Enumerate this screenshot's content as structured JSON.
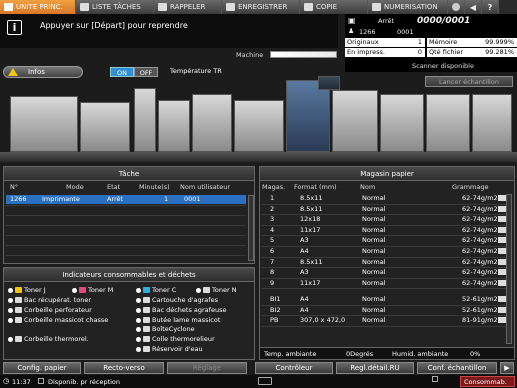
{
  "tabs": [
    {
      "label": "UNITE PRINC.",
      "icon": "home-icon",
      "active": true
    },
    {
      "label": "LISTE TÂCHES",
      "icon": "list-icon",
      "active": false
    },
    {
      "label": "RAPPELER",
      "icon": "folder-icon",
      "active": false
    },
    {
      "label": "ENREGISTRER",
      "icon": "save-icon",
      "active": false
    },
    {
      "label": "COPIE",
      "icon": "copy-icon",
      "active": false
    },
    {
      "label": "NUMERISATION",
      "icon": "scan-icon",
      "active": false
    }
  ],
  "message": "Appuyer sur [Départ] pour reprendre",
  "status": {
    "state_label": "Arrêt",
    "counter": "0000/0001",
    "job_id": "1266",
    "job_count": "0001",
    "originals_label": "Originaux",
    "originals_value": "1",
    "memory_label": "Mémoire",
    "memory_value": "99.999%",
    "printing_label": "En impress.",
    "printing_value": "0",
    "file_qty_label": "Qté fichier",
    "file_qty_value": "99.281%"
  },
  "machine_label": "Machine",
  "machine_progress": 1.0,
  "infos_label": "Infos",
  "on_label": "ON",
  "off_label": "OFF",
  "temp_label": "Température TR",
  "scanner_status": "Scanner disponible",
  "scan_sample_label": "Lancer échantillon",
  "jobs": {
    "title": "Tâche",
    "headers": [
      "N°",
      "Mode",
      "Etat",
      "Minute(s)",
      "Nom utilisateur"
    ],
    "rows": [
      {
        "no": "1266",
        "mode": "Imprimante",
        "state": "Arrêt",
        "minutes": "1",
        "user": "0001"
      }
    ]
  },
  "consumables": {
    "title": "Indicateurs consommables et déchets",
    "items": [
      "Toner J",
      "Toner M",
      "Toner C",
      "Toner N",
      "Bac récupérat. toner",
      "Cartouche d'agrafes",
      "Corbeille perforateur",
      "Bac déchets agrafeuse",
      "Corbeille massicot chasse",
      "Butée lame massicot",
      "BoîteCyclone",
      "Corbeille thermorel.",
      "Colle thermorelieur",
      "Réservoir d'eau"
    ]
  },
  "paper": {
    "title": "Magasin papier",
    "headers": [
      "Magas.",
      "Format (mm)",
      "Nom",
      "Grammage"
    ],
    "rows": [
      {
        "tray": "1",
        "size": "8.5x11",
        "name": "Normal",
        "weight": "62-74g/m2",
        "level": 0.8
      },
      {
        "tray": "2",
        "size": "8.5x11",
        "name": "Normal",
        "weight": "62-74g/m2",
        "level": 0.8
      },
      {
        "tray": "3",
        "size": "12x18",
        "name": "Normal",
        "weight": "62-74g/m2",
        "level": 0.8
      },
      {
        "tray": "4",
        "size": "11x17",
        "name": "Normal",
        "weight": "62-74g/m2",
        "level": 0.8
      },
      {
        "tray": "5",
        "size": "A3",
        "name": "Normal",
        "weight": "62-74g/m2",
        "level": 0.8
      },
      {
        "tray": "6",
        "size": "A4",
        "name": "Normal",
        "weight": "62-74g/m2",
        "level": 0.8
      },
      {
        "tray": "7",
        "size": "8.5x11",
        "name": "Normal",
        "weight": "62-74g/m2",
        "level": 0.8
      },
      {
        "tray": "8",
        "size": "A3",
        "name": "Normal",
        "weight": "62-74g/m2",
        "level": 0.8
      },
      {
        "tray": "9",
        "size": "11x17",
        "name": "Normal",
        "weight": "62-74g/m2",
        "level": 0.8
      },
      {
        "tray": "BI1",
        "size": "A4",
        "name": "Normal",
        "weight": "52-61g/m2",
        "level": 0.8
      },
      {
        "tray": "BI2",
        "size": "A4",
        "name": "Normal",
        "weight": "52-61g/m2",
        "level": 0.8
      },
      {
        "tray": "PB",
        "size": "307,0 x 472,0",
        "name": "Normal",
        "weight": "81-91g/m2",
        "level": 0.8
      }
    ],
    "ambient_temp_label": "Temp. ambiante",
    "ambient_temp_value": "0Degrés",
    "humidity_label": "Humid. ambiante",
    "humidity_value": "0%"
  },
  "bottom_buttons": [
    {
      "label": "Config. papier",
      "enabled": true
    },
    {
      "label": "Recto-verso",
      "enabled": true
    },
    {
      "label": "Réglage",
      "enabled": false
    },
    {
      "label": "Contrôleur",
      "enabled": true
    },
    {
      "label": "Regl.détail.RU",
      "enabled": true
    },
    {
      "label": "Conf. échantillon",
      "enabled": true
    }
  ],
  "footer": {
    "time": "11:37",
    "status": "Disponib. pr réception",
    "consumables_label": "Consommab."
  }
}
